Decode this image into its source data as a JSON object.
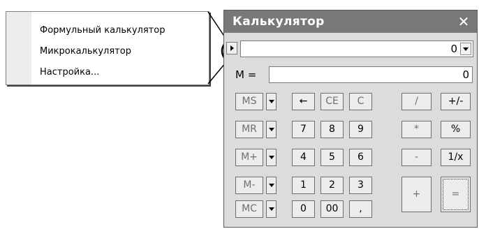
{
  "menu": {
    "items": [
      {
        "label": "Формульный калькулятор"
      },
      {
        "label": "Микрокалькулятор"
      },
      {
        "label": "Настройка..."
      }
    ]
  },
  "window": {
    "title": "Калькулятор",
    "close_glyph": "✕"
  },
  "display": {
    "value": "0"
  },
  "memory": {
    "label": "M =",
    "value": "0"
  },
  "memory_buttons": [
    "MS",
    "MR",
    "M+",
    "M-",
    "MC"
  ],
  "keys": {
    "back": "←",
    "ce": "CE",
    "c": "C",
    "d7": "7",
    "d8": "8",
    "d9": "9",
    "d4": "4",
    "d5": "5",
    "d6": "6",
    "d1": "1",
    "d2": "2",
    "d3": "3",
    "d0": "0",
    "d00": "00",
    "dot": ",",
    "div": "/",
    "sign": "+/-",
    "mul": "*",
    "pct": "%",
    "sub": "-",
    "inv": "1/x",
    "add": "+",
    "eq": "="
  }
}
